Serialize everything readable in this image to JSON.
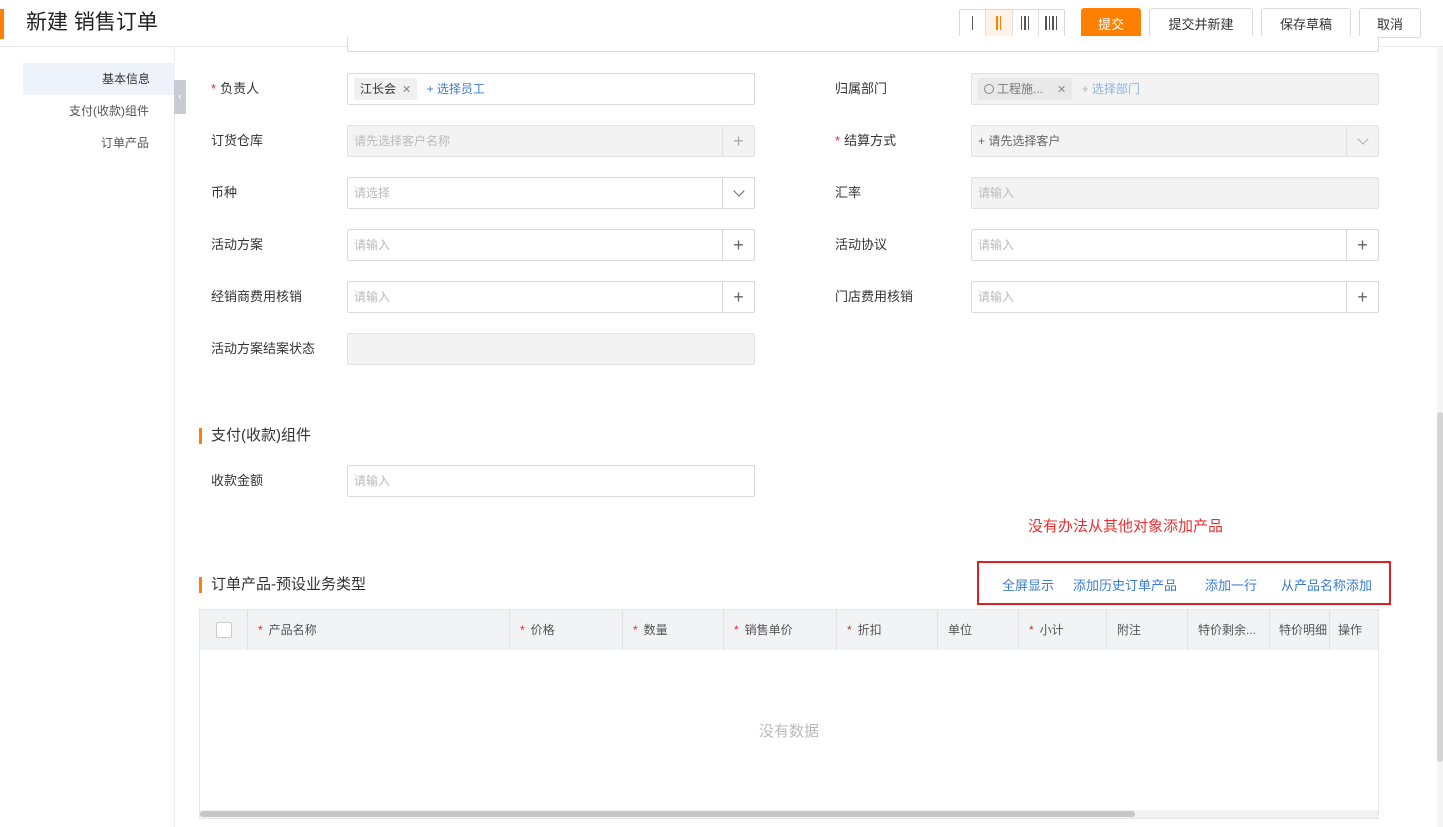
{
  "header": {
    "title": "新建 销售订单",
    "layout_options": [
      "I",
      "II",
      "III",
      "IIII"
    ],
    "active_layout": "II",
    "buttons": {
      "submit": "提交",
      "submit_new": "提交并新建",
      "save_draft": "保存草稿",
      "cancel": "取消"
    }
  },
  "sidebar": {
    "items": [
      {
        "label": "基本信息"
      },
      {
        "label": "支付(收款)组件"
      },
      {
        "label": "订单产品"
      }
    ]
  },
  "form": {
    "owner": {
      "label": "负责人",
      "tag": "江长会",
      "add": "+ 选择员工"
    },
    "department": {
      "label": "归属部门",
      "tag": "工程施...",
      "add": "+ 选择部门"
    },
    "warehouse": {
      "label": "订货仓库",
      "placeholder": "请先选择客户名称"
    },
    "settlement": {
      "label": "结算方式",
      "placeholder": "+ 请先选择客户"
    },
    "currency": {
      "label": "币种",
      "placeholder": "请选择"
    },
    "exchange_rate": {
      "label": "汇率",
      "placeholder": "请输入"
    },
    "activity_plan": {
      "label": "活动方案",
      "placeholder": "请输入"
    },
    "activity_agreement": {
      "label": "活动协议",
      "placeholder": "请输入"
    },
    "dealer_expense": {
      "label": "经销商费用核销",
      "placeholder": "请输入"
    },
    "store_expense": {
      "label": "门店费用核销",
      "placeholder": "请输入"
    },
    "plan_status": {
      "label": "活动方案结案状态"
    }
  },
  "payment_section": {
    "title": "支付(收款)组件",
    "amount": {
      "label": "收款金额",
      "placeholder": "请输入"
    }
  },
  "annotation": "没有办法从其他对象添加产品",
  "products_section": {
    "title": "订单产品-预设业务类型",
    "actions": [
      "全屏显示",
      "添加历史订单产品",
      "添加一行",
      "从产品名称添加"
    ],
    "columns": [
      {
        "label": "产品名称",
        "required": true
      },
      {
        "label": "价格",
        "required": true
      },
      {
        "label": "数量",
        "required": true
      },
      {
        "label": "销售单价",
        "required": true
      },
      {
        "label": "折扣",
        "required": true
      },
      {
        "label": "单位",
        "required": false
      },
      {
        "label": "小计",
        "required": true
      },
      {
        "label": "附注",
        "required": false
      },
      {
        "label": "特价剩余...",
        "required": false
      },
      {
        "label": "特价明细",
        "required": false
      },
      {
        "label": "操作",
        "required": false
      }
    ],
    "empty_text": "没有数据"
  },
  "colors": {
    "accent": "#ff8000",
    "link": "#3b7cd1",
    "annotation": "#e83030"
  }
}
